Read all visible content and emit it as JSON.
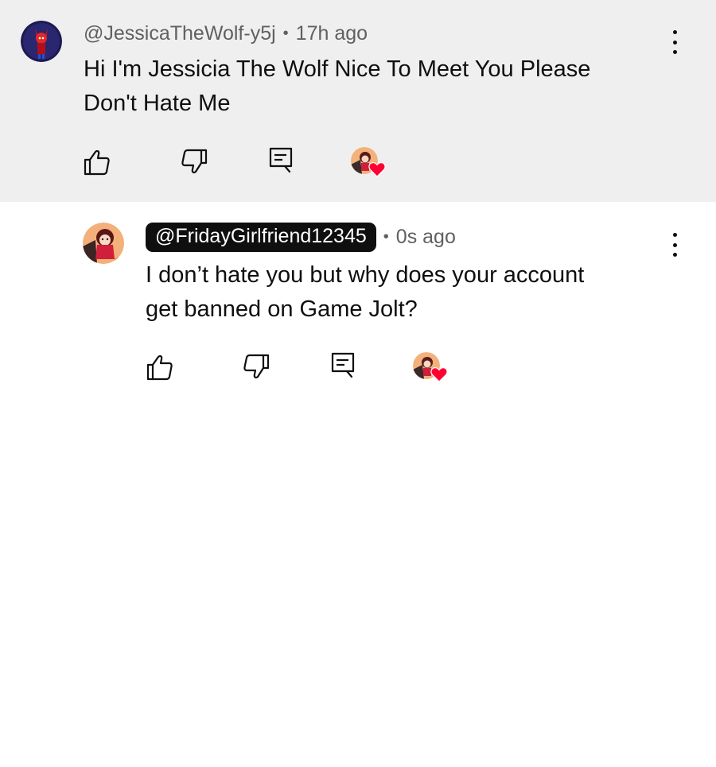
{
  "comments": [
    {
      "handle": "@JessicaTheWolf-y5j",
      "time": "17h ago",
      "text_line1": "Hi I'm Jessicia The Wolf Nice To Meet You Please",
      "text_line2": "Don't Hate Me"
    },
    {
      "handle": "@FridayGirlfriend12345",
      "time": "0s ago",
      "text_line1": "I don’t hate you but why does your account",
      "text_line2": "get banned on Game Jolt?"
    }
  ],
  "separator": "•",
  "icons": {
    "like": "thumbs-up-icon",
    "dislike": "thumbs-down-icon",
    "reply": "reply-comment-icon",
    "creator_heart": "creator-heart-icon",
    "more": "more-vertical-icon"
  },
  "colors": {
    "parent_bg": "#efefef",
    "text": "#0f0f0f",
    "meta": "#606060",
    "heart": "#ff0033",
    "pill_bg": "#0f0f0f"
  }
}
